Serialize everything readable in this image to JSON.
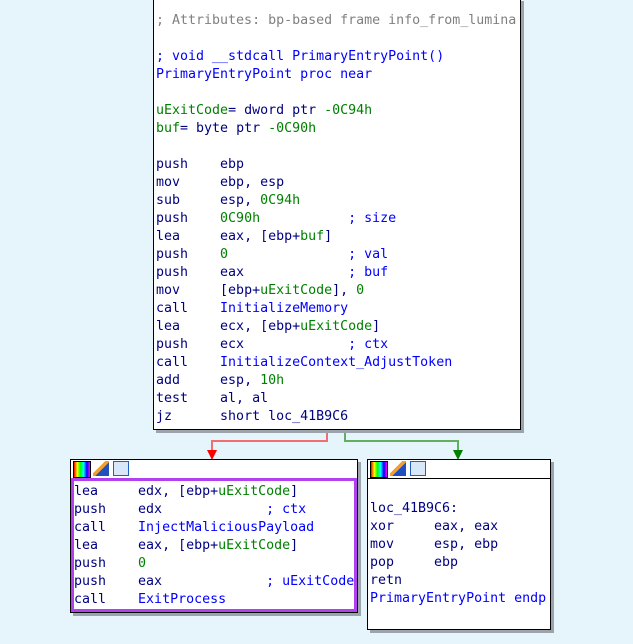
{
  "colors": {
    "background": "#e6f4fb",
    "selected_border": "#b040f0",
    "edge_false": "#f07070",
    "edge_true": "#60b060"
  },
  "header_icons": [
    "color-palette-icon",
    "edit-pencil-icon",
    "graph-layout-icon"
  ],
  "main_block": {
    "lines": [
      [
        [
          "; Attributes: bp-based frame info_from_lumina",
          "gcmt"
        ]
      ],
      [],
      [
        [
          "; void __stdcall PrimaryEntryPoint()",
          "name"
        ]
      ],
      [
        [
          "PrimaryEntryPoint proc near",
          "name"
        ]
      ],
      [],
      [
        [
          "uExitCode",
          "var"
        ],
        [
          "= dword ptr ",
          "op"
        ],
        [
          "-0C94h",
          "num"
        ]
      ],
      [
        [
          "buf",
          "var"
        ],
        [
          "= byte ptr ",
          "op"
        ],
        [
          "-0C90h",
          "num"
        ]
      ],
      [],
      [
        [
          "push    ",
          "mn"
        ],
        [
          "ebp",
          "op"
        ]
      ],
      [
        [
          "mov     ",
          "mn"
        ],
        [
          "ebp, esp",
          "op"
        ]
      ],
      [
        [
          "sub     ",
          "mn"
        ],
        [
          "esp, ",
          "op"
        ],
        [
          "0C94h",
          "num"
        ]
      ],
      [
        [
          "push    ",
          "mn"
        ],
        [
          "0C90h",
          "num"
        ],
        [
          "           ; size",
          "cmt"
        ]
      ],
      [
        [
          "lea     ",
          "mn"
        ],
        [
          "eax, [ebp+",
          "op"
        ],
        [
          "buf",
          "var"
        ],
        [
          "]",
          "op"
        ]
      ],
      [
        [
          "push    ",
          "mn"
        ],
        [
          "0",
          "num"
        ],
        [
          "               ; val",
          "cmt"
        ]
      ],
      [
        [
          "push    ",
          "mn"
        ],
        [
          "eax",
          "op"
        ],
        [
          "             ; buf",
          "cmt"
        ]
      ],
      [
        [
          "mov     ",
          "mn"
        ],
        [
          "[ebp+",
          "op"
        ],
        [
          "uExitCode",
          "var"
        ],
        [
          "], ",
          "op"
        ],
        [
          "0",
          "num"
        ]
      ],
      [
        [
          "call    ",
          "mn"
        ],
        [
          "InitializeMemory",
          "name"
        ]
      ],
      [
        [
          "lea     ",
          "mn"
        ],
        [
          "ecx, [ebp+",
          "op"
        ],
        [
          "uExitCode",
          "var"
        ],
        [
          "]",
          "op"
        ]
      ],
      [
        [
          "push    ",
          "mn"
        ],
        [
          "ecx",
          "op"
        ],
        [
          "             ; ctx",
          "cmt"
        ]
      ],
      [
        [
          "call    ",
          "mn"
        ],
        [
          "InitializeContext_AdjustToken",
          "name"
        ]
      ],
      [
        [
          "add     ",
          "mn"
        ],
        [
          "esp, ",
          "op"
        ],
        [
          "10h",
          "num"
        ]
      ],
      [
        [
          "test    ",
          "mn"
        ],
        [
          "al, al",
          "op"
        ]
      ],
      [
        [
          "jz      ",
          "mn"
        ],
        [
          "short loc_41B9C6",
          "op"
        ]
      ]
    ]
  },
  "false_block": {
    "lines": [
      [
        [
          "lea     ",
          "mn"
        ],
        [
          "edx, [ebp+",
          "op"
        ],
        [
          "uExitCode",
          "var"
        ],
        [
          "]",
          "op"
        ]
      ],
      [
        [
          "push    ",
          "mn"
        ],
        [
          "edx",
          "op"
        ],
        [
          "             ; ctx",
          "cmt"
        ]
      ],
      [
        [
          "call    ",
          "mn"
        ],
        [
          "InjectMaliciousPayload",
          "name"
        ]
      ],
      [
        [
          "lea     ",
          "mn"
        ],
        [
          "eax, [ebp+",
          "op"
        ],
        [
          "uExitCode",
          "var"
        ],
        [
          "]",
          "op"
        ]
      ],
      [
        [
          "push    ",
          "mn"
        ],
        [
          "0",
          "num"
        ]
      ],
      [
        [
          "push    ",
          "mn"
        ],
        [
          "eax",
          "op"
        ],
        [
          "             ; uExitCode",
          "cmt"
        ]
      ],
      [
        [
          "call    ",
          "mn"
        ],
        [
          "ExitProcess",
          "name"
        ]
      ]
    ]
  },
  "true_block": {
    "lines": [
      [],
      [
        [
          "loc_41B9C6:",
          "lbl"
        ]
      ],
      [
        [
          "xor     ",
          "mn"
        ],
        [
          "eax, eax",
          "op"
        ]
      ],
      [
        [
          "mov     ",
          "mn"
        ],
        [
          "esp, ebp",
          "op"
        ]
      ],
      [
        [
          "pop     ",
          "mn"
        ],
        [
          "ebp",
          "op"
        ]
      ],
      [
        [
          "retn",
          "mn"
        ]
      ],
      [
        [
          "PrimaryEntryPoint endp",
          "name"
        ]
      ]
    ]
  }
}
